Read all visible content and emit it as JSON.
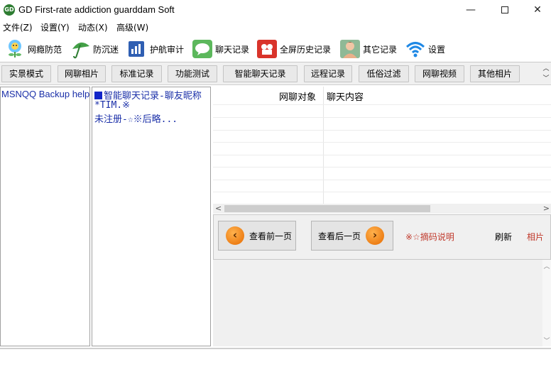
{
  "window": {
    "title": "GD First-rate addiction guarddam Soft",
    "icon_label": "GD",
    "minimize": "—",
    "close": "✕"
  },
  "menu": [
    "文件(Z)",
    "设置(Y)",
    "动态(X)",
    "高级(W)"
  ],
  "toolbar": [
    {
      "label": "网瘾防范",
      "icon": "flower-icon"
    },
    {
      "label": "防沉迷",
      "icon": "umbrella-icon"
    },
    {
      "label": "护航审计",
      "icon": "document-chart-icon"
    },
    {
      "label": "聊天记录",
      "icon": "chat-bubble-icon"
    },
    {
      "label": "全屏历史记录",
      "icon": "camera-icon"
    },
    {
      "label": "其它记录",
      "icon": "person-icon"
    },
    {
      "label": "设置",
      "icon": "wifi-icon"
    }
  ],
  "tabs": [
    "实景模式",
    "网聊相片",
    "标准记录",
    "功能测试",
    "智能聊天记录",
    "远程记录",
    "低俗过滤",
    "网聊视频",
    "其他相片"
  ],
  "left_panel": {
    "item": "MSNQQ Backup help"
  },
  "middle_panel": {
    "line1": "智能聊天记录-聊友昵称",
    "line2": "*TIM.※",
    "line3": "未注册-☆※后略..."
  },
  "table": {
    "columns": [
      "网聊对象",
      "聊天内容"
    ]
  },
  "navigation": {
    "prev_label": "查看前一页",
    "next_label": "查看后一页",
    "prev_arrow": "‹",
    "next_arrow": "›",
    "note": "※☆摘码说明",
    "refresh": "刷新",
    "photo": "相片"
  },
  "colors": {
    "accent_blue": "#1a2fa8",
    "note_red": "#c0392b",
    "arrow_orange": "#e66a00"
  }
}
